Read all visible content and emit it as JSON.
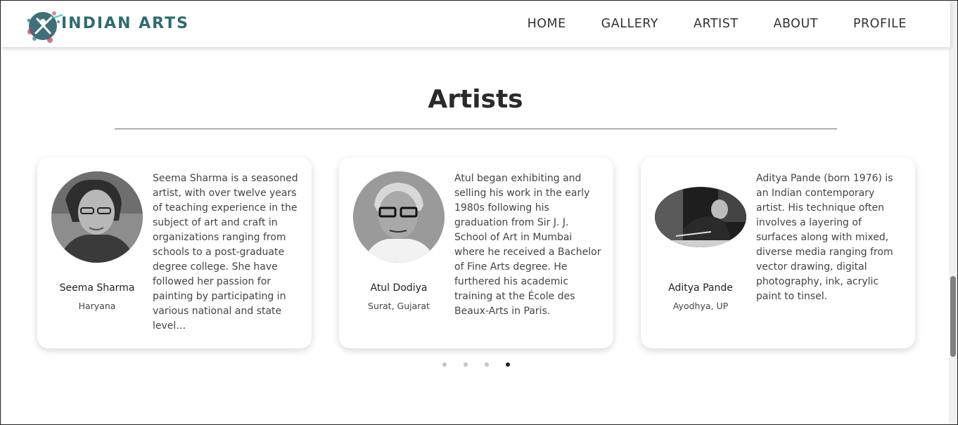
{
  "brand": {
    "name": "INDIAN ARTS"
  },
  "nav": {
    "items": [
      {
        "label": "HOME"
      },
      {
        "label": "GALLERY"
      },
      {
        "label": "ARTIST"
      },
      {
        "label": "ABOUT"
      },
      {
        "label": "PROFILE"
      }
    ]
  },
  "section": {
    "title": "Artists"
  },
  "artists": [
    {
      "name": "Seema Sharma",
      "place": "Haryana",
      "bio": "Seema Sharma is a seasoned artist, with over twelve years of teaching experience in the subject of art and craft in organizations ranging from schools to a post-graduate degree college. She have followed her passion for painting by participating in various national and state level…"
    },
    {
      "name": "Atul Dodiya",
      "place": "Surat, Gujarat",
      "bio": "Atul began exhibiting and selling his work in the early 1980s following his graduation from Sir J. J. School of Art in Mumbai where he received a Bachelor of Fine Arts degree. He furthered his academic training at the École des Beaux-Arts in Paris."
    },
    {
      "name": "Aditya Pande",
      "place": "Ayodhya, UP",
      "bio": "Aditya Pande (born 1976) is an Indian contemporary artist. His technique often involves a layering of surfaces along with mixed, diverse media ranging from vector drawing, digital photography, ink, acrylic paint to tinsel."
    }
  ],
  "carousel": {
    "active_index": 3,
    "count": 4
  },
  "colors": {
    "brand": "#2f6b72",
    "text": "#333333",
    "accent_dot": "#222222"
  },
  "icons": {
    "logo": "palette-logo-icon"
  }
}
